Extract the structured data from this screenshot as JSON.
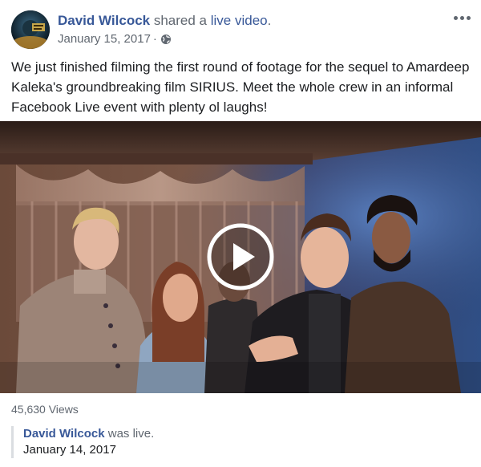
{
  "post": {
    "author": "David Wilcock",
    "action_prefix": "shared a",
    "action_link": "live video",
    "action_suffix": ".",
    "date": "January 15, 2017",
    "separator": "·",
    "privacy_icon": "globe-icon",
    "more_icon": "ellipsis-icon",
    "text": "We just finished filming the first round of footage for the sequel to Amardeep Kaleka's groundbreaking film SIRIUS. Meet the whole crew in an informal Facebook Live event with plenty ol laughs!"
  },
  "video": {
    "play_icon": "play-icon",
    "views": "45,630 Views"
  },
  "live": {
    "author": "David Wilcock",
    "action": "was live.",
    "date": "January 14, 2017"
  },
  "colors": {
    "link": "#385898",
    "secondary": "#606770",
    "text": "#1c1e21",
    "border": "#dadde1"
  }
}
